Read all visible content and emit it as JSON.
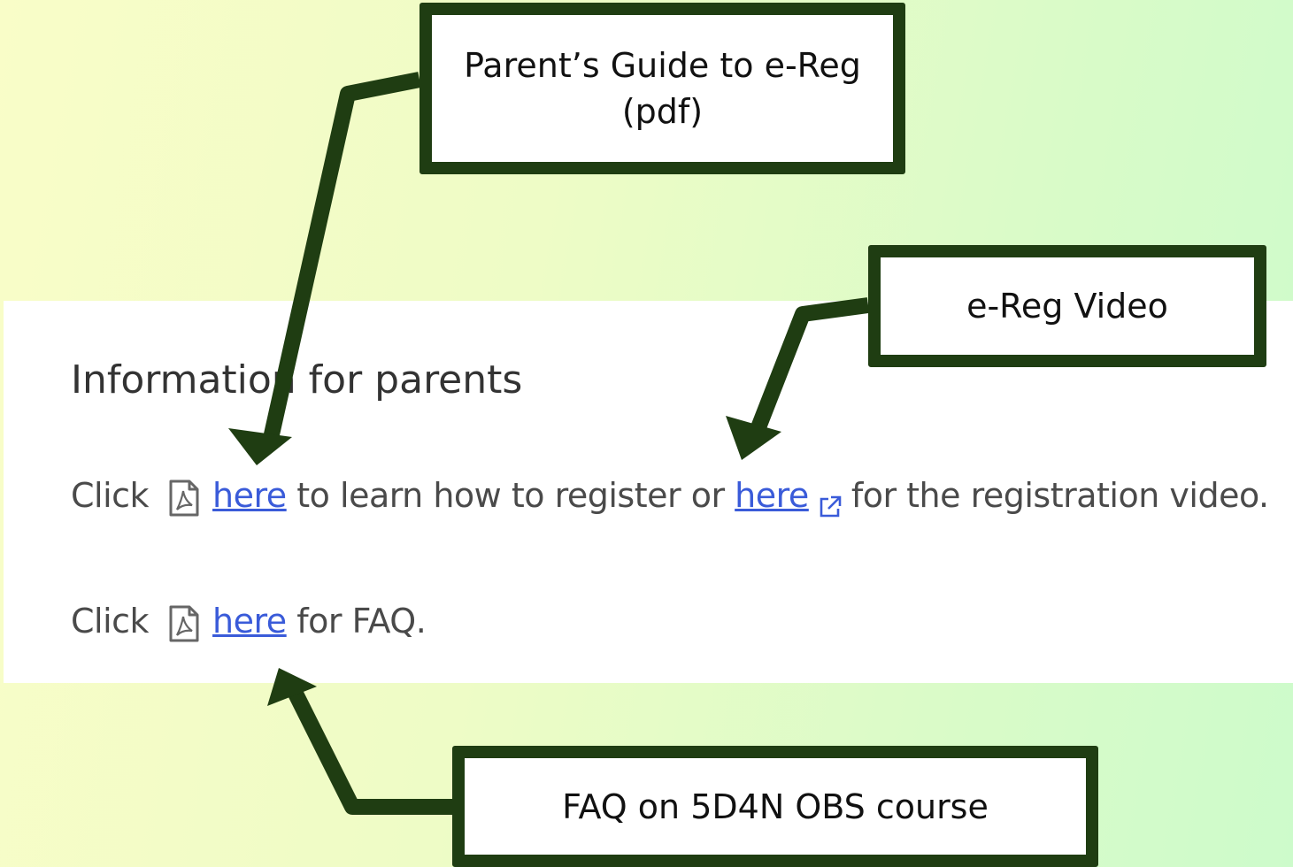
{
  "section": {
    "heading": "Information for parents",
    "line1": {
      "prefix": "Click",
      "link1": "here",
      "middle": "to learn how to register or",
      "link2": "here",
      "suffix": "for the registration video."
    },
    "line2": {
      "prefix": "Click",
      "link": "here",
      "suffix": "for FAQ."
    }
  },
  "callouts": {
    "guide": "Parent’s Guide to e-Reg (pdf)",
    "video": "e-Reg Video",
    "faq": "FAQ on 5D4N OBS course"
  },
  "icons": [
    "pdf-icon",
    "external-link-icon",
    "arrow-icon"
  ],
  "colors": {
    "callout_border": "#1f3d12",
    "link": "#3a5bd9",
    "text": "#4a4a4a"
  }
}
